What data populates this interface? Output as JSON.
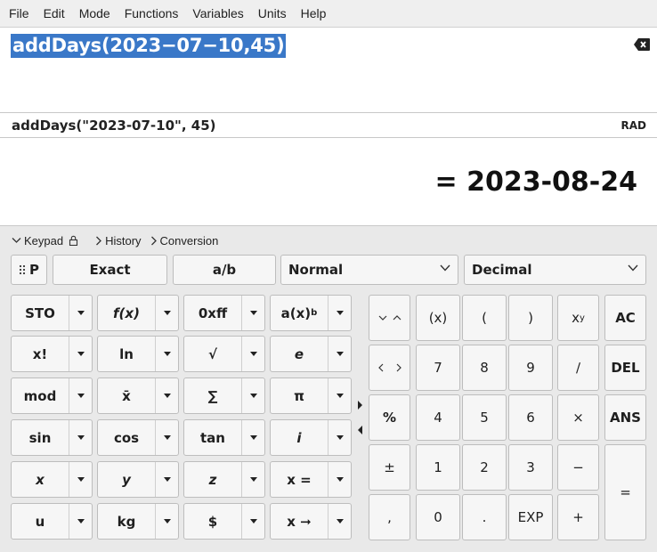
{
  "menu": [
    "File",
    "Edit",
    "Mode",
    "Functions",
    "Variables",
    "Units",
    "Help"
  ],
  "expression": "addDays(2023−07−10,45)",
  "parsed": "addDays(\"2023-07-10\", 45)",
  "angle_mode": "RAD",
  "result": "= 2023-08-24",
  "tabs": {
    "keypad": "Keypad",
    "history": "History",
    "conversion": "Conversion"
  },
  "toolbar": {
    "p_button": "P",
    "exact": "Exact",
    "fraction": "a/b",
    "display_mode": "Normal",
    "base": "Decimal"
  },
  "function_keys": [
    [
      "STO",
      "f(x)",
      "0xff",
      "a(x)"
    ],
    [
      "x!",
      "ln",
      "√",
      "e"
    ],
    [
      "mod",
      "x̄",
      "∑",
      "π"
    ],
    [
      "sin",
      "cos",
      "tan",
      "i"
    ],
    [
      "x",
      "y",
      "z",
      "x ="
    ],
    [
      "u",
      "kg",
      "$",
      "x ➞"
    ]
  ],
  "power_sup": "b",
  "num_keys": {
    "row1": [
      "(x)",
      "(",
      ")",
      "x",
      "AC"
    ],
    "xy_sup": "y",
    "row2": [
      "7",
      "8",
      "9",
      "∕",
      "DEL"
    ],
    "row3": [
      "%",
      "4",
      "5",
      "6",
      "×",
      "ANS"
    ],
    "row4": [
      "±",
      "1",
      "2",
      "3",
      "−"
    ],
    "row5": [
      ",",
      "0",
      ".",
      "EXP",
      "+"
    ],
    "equals": "="
  }
}
